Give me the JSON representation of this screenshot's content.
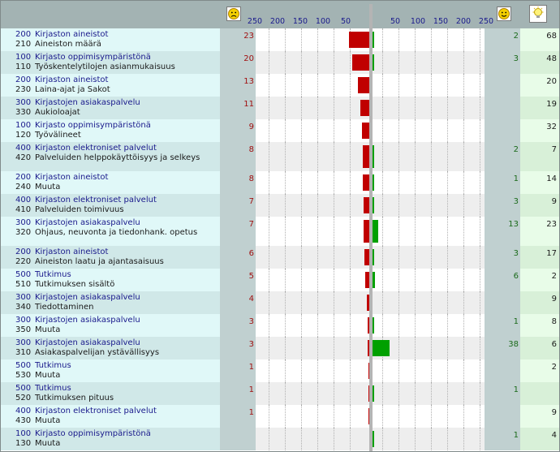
{
  "header": {
    "sad_face": "sad-face-icon",
    "happy_face": "happy-face-icon",
    "bulb": "lightbulb-icon",
    "left_ticks": [
      "250",
      "200",
      "150",
      "100",
      "50"
    ],
    "right_ticks": [
      "50",
      "100",
      "150",
      "200",
      "250"
    ]
  },
  "scale": {
    "max": 250
  },
  "colors": {
    "negative": "#c00000",
    "positive": "#00a000",
    "header": "#a3b3b3"
  },
  "rows": [
    {
      "cat_code": "200",
      "cat": "Kirjaston aineistot",
      "sub_code": "210",
      "sub": "Aineiston määrä",
      "neg": 23,
      "pos": 2,
      "sugg": 68
    },
    {
      "cat_code": "100",
      "cat": "Kirjasto oppimisympäristönä",
      "sub_code": "110",
      "sub": "Työskentelytilojen asianmukaisuus",
      "neg": 20,
      "pos": 3,
      "sugg": 48
    },
    {
      "cat_code": "200",
      "cat": "Kirjaston aineistot",
      "sub_code": "230",
      "sub": "Laina-ajat ja Sakot",
      "neg": 13,
      "pos": null,
      "sugg": 20
    },
    {
      "cat_code": "300",
      "cat": "Kirjastojen asiakaspalvelu",
      "sub_code": "330",
      "sub": "Aukioloajat",
      "neg": 11,
      "pos": null,
      "sugg": 19
    },
    {
      "cat_code": "100",
      "cat": "Kirjasto oppimisympäristönä",
      "sub_code": "120",
      "sub": "Työvälineet",
      "neg": 9,
      "pos": null,
      "sugg": 32
    },
    {
      "cat_code": "400",
      "cat": "Kirjaston elektroniset palvelut",
      "sub_code": "420",
      "sub": "Palveluiden helppokäyttöisyys ja selkeys",
      "neg": 8,
      "pos": 2,
      "sugg": 7
    },
    {
      "cat_code": "200",
      "cat": "Kirjaston aineistot",
      "sub_code": "240",
      "sub": "Muuta",
      "neg": 8,
      "pos": 1,
      "sugg": 14
    },
    {
      "cat_code": "400",
      "cat": "Kirjaston elektroniset palvelut",
      "sub_code": "410",
      "sub": "Palveluiden toimivuus",
      "neg": 7,
      "pos": 3,
      "sugg": 9
    },
    {
      "cat_code": "300",
      "cat": "Kirjastojen asiakaspalvelu",
      "sub_code": "320",
      "sub": "Ohjaus, neuvonta ja tiedonhank. opetus",
      "neg": 7,
      "pos": 13,
      "sugg": 23
    },
    {
      "cat_code": "200",
      "cat": "Kirjaston aineistot",
      "sub_code": "220",
      "sub": "Aineiston laatu ja ajantasaisuus",
      "neg": 6,
      "pos": 3,
      "sugg": 17
    },
    {
      "cat_code": "500",
      "cat": "Tutkimus",
      "sub_code": "510",
      "sub": "Tutkimuksen sisältö",
      "neg": 5,
      "pos": 6,
      "sugg": 2
    },
    {
      "cat_code": "300",
      "cat": "Kirjastojen asiakaspalvelu",
      "sub_code": "340",
      "sub": "Tiedottaminen",
      "neg": 4,
      "pos": null,
      "sugg": 9
    },
    {
      "cat_code": "300",
      "cat": "Kirjastojen asiakaspalvelu",
      "sub_code": "350",
      "sub": "Muuta",
      "neg": 3,
      "pos": 1,
      "sugg": 8
    },
    {
      "cat_code": "300",
      "cat": "Kirjastojen asiakaspalvelu",
      "sub_code": "310",
      "sub": "Asiakaspalvelijan ystävällisyys",
      "neg": 3,
      "pos": 38,
      "sugg": 6
    },
    {
      "cat_code": "500",
      "cat": "Tutkimus",
      "sub_code": "530",
      "sub": "Muuta",
      "neg": 1,
      "pos": null,
      "sugg": 2
    },
    {
      "cat_code": "500",
      "cat": "Tutkimus",
      "sub_code": "520",
      "sub": "Tutkimuksen pituus",
      "neg": 1,
      "pos": 1,
      "sugg": null
    },
    {
      "cat_code": "400",
      "cat": "Kirjaston elektroniset palvelut",
      "sub_code": "430",
      "sub": "Muuta",
      "neg": 1,
      "pos": null,
      "sugg": 9
    },
    {
      "cat_code": "100",
      "cat": "Kirjasto oppimisympäristönä",
      "sub_code": "130",
      "sub": "Muuta",
      "neg": null,
      "pos": 1,
      "sugg": 4
    }
  ]
}
